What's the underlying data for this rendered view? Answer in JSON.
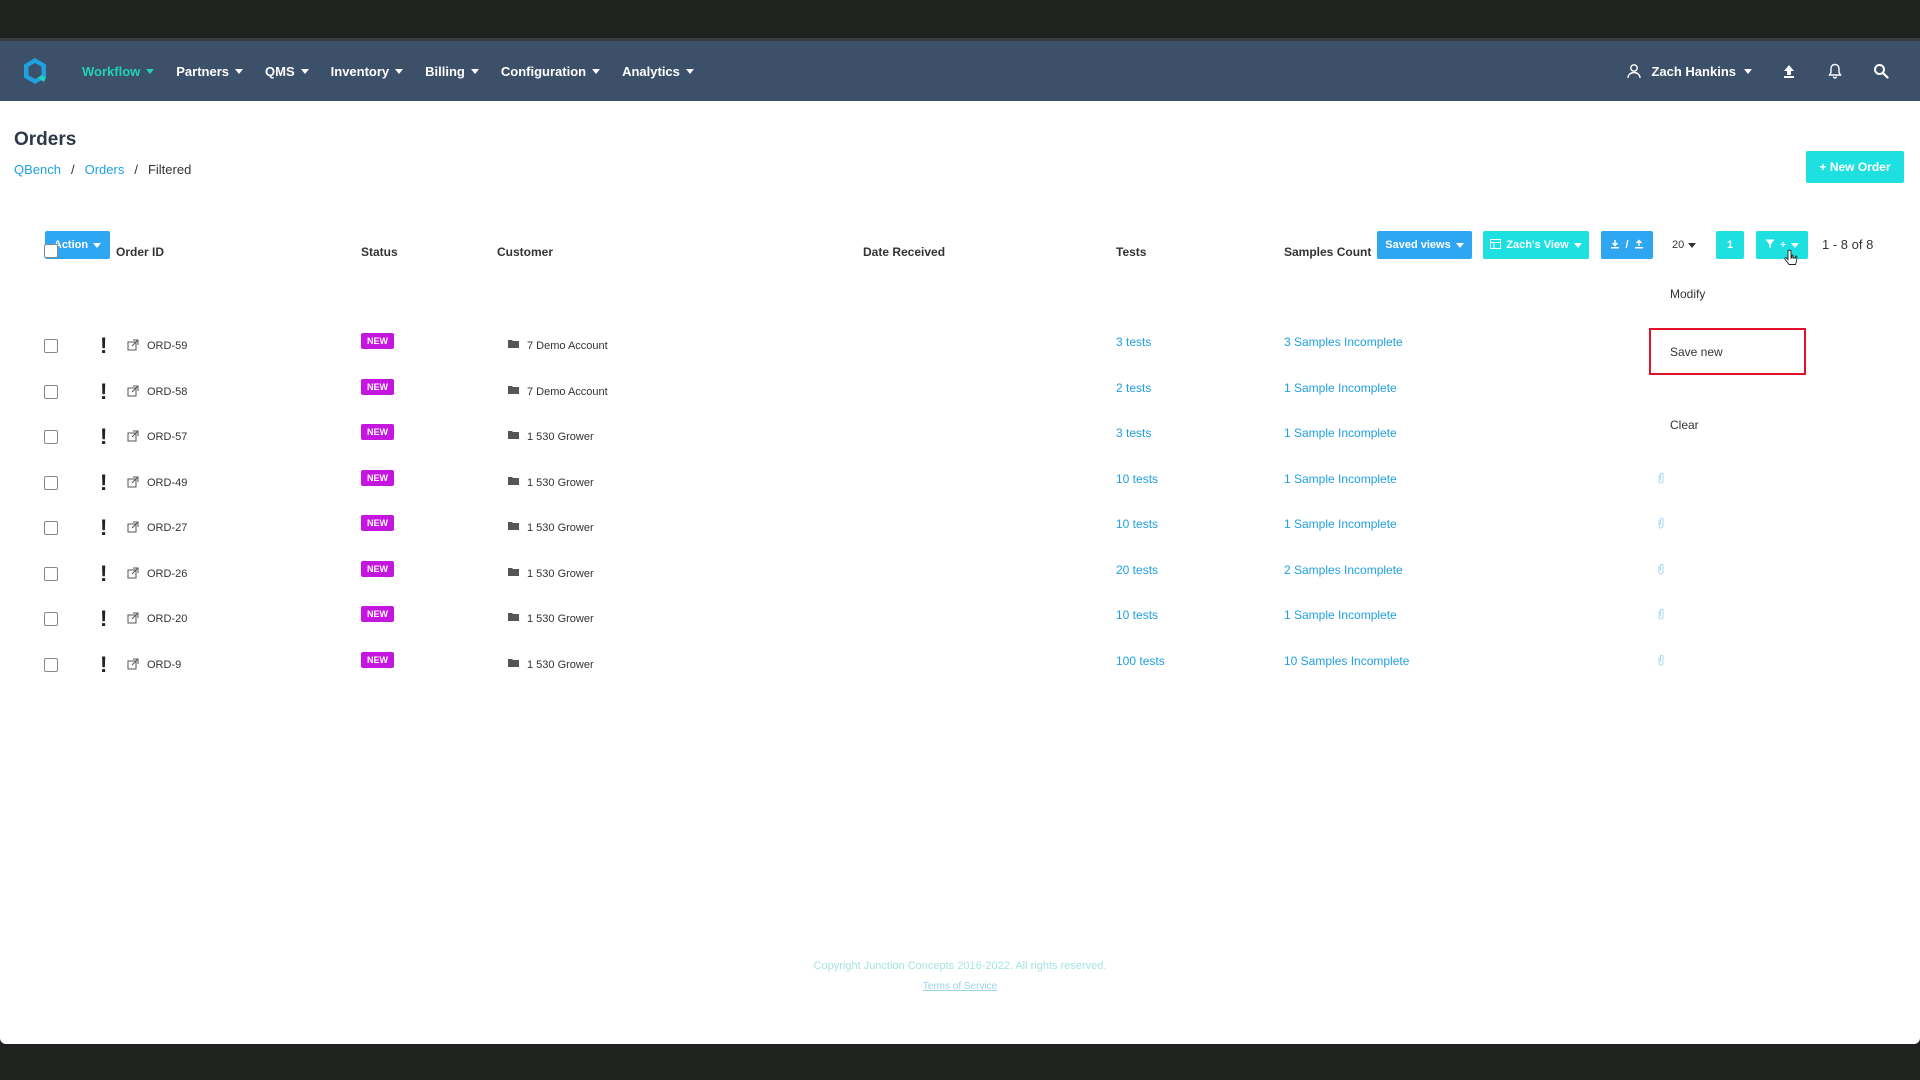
{
  "nav": {
    "items": [
      {
        "label": "Workflow",
        "active": true
      },
      {
        "label": "Partners"
      },
      {
        "label": "QMS"
      },
      {
        "label": "Inventory"
      },
      {
        "label": "Billing"
      },
      {
        "label": "Configuration"
      },
      {
        "label": "Analytics"
      }
    ],
    "user": "Zach Hankins"
  },
  "page": {
    "title": "Orders",
    "breadcrumb": [
      "QBench",
      "Orders",
      "Filtered"
    ],
    "new_order": "+ New Order"
  },
  "toolbar": {
    "action": "Action",
    "saved_views": "Saved views",
    "zachs_view": "Zach's View",
    "per_page": "20",
    "page": "1",
    "pager": "1 - 8 of 8"
  },
  "table": {
    "headers": [
      "Order ID",
      "Status",
      "Customer",
      "Date Received",
      "Tests",
      "Samples Count"
    ],
    "rows": [
      {
        "id": "ORD-59",
        "status": "NEW",
        "customer": "7  Demo Account",
        "tests": "3 tests",
        "samples": "3 Samples Incomplete"
      },
      {
        "id": "ORD-58",
        "status": "NEW",
        "customer": "7  Demo Account",
        "tests": "2 tests",
        "samples": "1 Sample Incomplete"
      },
      {
        "id": "ORD-57",
        "status": "NEW",
        "customer": "1  530 Grower",
        "tests": "3 tests",
        "samples": "1 Sample Incomplete"
      },
      {
        "id": "ORD-49",
        "status": "NEW",
        "customer": "1  530 Grower",
        "tests": "10 tests",
        "samples": "1 Sample Incomplete"
      },
      {
        "id": "ORD-27",
        "status": "NEW",
        "customer": "1  530 Grower",
        "tests": "10 tests",
        "samples": "1 Sample Incomplete"
      },
      {
        "id": "ORD-26",
        "status": "NEW",
        "customer": "1  530 Grower",
        "tests": "20 tests",
        "samples": "2 Samples Incomplete"
      },
      {
        "id": "ORD-20",
        "status": "NEW",
        "customer": "1  530 Grower",
        "tests": "10 tests",
        "samples": "1 Sample Incomplete"
      },
      {
        "id": "ORD-9",
        "status": "NEW",
        "customer": "1  530 Grower",
        "tests": "100 tests",
        "samples": "10 Samples Incomplete"
      }
    ]
  },
  "filter_menu": {
    "modify": "Modify",
    "save_new": "Save new",
    "clear": "Clear"
  },
  "footer": {
    "copyright": "Copyright Junction Concepts 2016-2022. All rights reserved.",
    "terms": "Terms of Service"
  },
  "colors": {
    "navbar": "#3c5069",
    "accent_teal": "#1ee0e0",
    "accent_blue": "#2fa6f2",
    "link": "#1fa0e0",
    "badge_new": "#c516e0",
    "highlight": "#e3102a"
  }
}
